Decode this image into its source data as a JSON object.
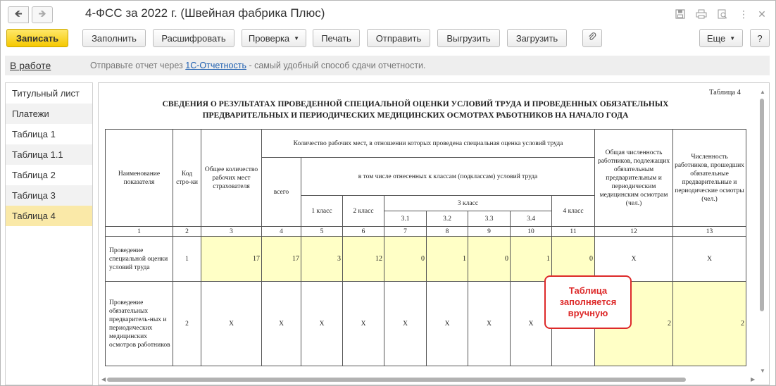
{
  "window": {
    "title": "4-ФСС за 2022 г. (Швейная фабрика Плюс)",
    "nav_back_icon": "arrow-left-icon",
    "nav_forward_icon": "arrow-right-icon"
  },
  "toolbar": {
    "save": "Записать",
    "fill": "Заполнить",
    "decode": "Расшифровать",
    "check": "Проверка",
    "print": "Печать",
    "send": "Отправить",
    "export": "Выгрузить",
    "import": "Загрузить",
    "more": "Еще",
    "help": "?"
  },
  "status": {
    "state": "В работе",
    "msg_before": "Отправьте отчет через ",
    "msg_link": "1С-Отчетность",
    "msg_after": " - самый удобный способ сдачи отчетности."
  },
  "sidebar": {
    "items": [
      {
        "label": "Титульный лист"
      },
      {
        "label": "Платежи"
      },
      {
        "label": "Таблица 1"
      },
      {
        "label": "Таблица 1.1"
      },
      {
        "label": "Таблица 2"
      },
      {
        "label": "Таблица 3"
      },
      {
        "label": "Таблица 4"
      }
    ],
    "active_index": 6
  },
  "document": {
    "table_label": "Таблица 4",
    "heading_line1": "СВЕДЕНИЯ  О РЕЗУЛЬТАТАХ ПРОВЕДЕННОЙ СПЕЦИАЛЬНОЙ ОЦЕНКИ УСЛОВИЙ ТРУДА И ПРОВЕДЕННЫХ ОБЯЗАТЕЛЬНЫХ",
    "heading_line2": "ПРЕДВАРИТЕЛЬНЫХ И ПЕРИОДИЧЕСКИХ МЕДИЦИНСКИХ ОСМОТРАХ РАБОТНИКОВ НА НАЧАЛО ГОДА",
    "headers": {
      "name": "Наименование показателя",
      "code": "Код стро-ки",
      "total_places": "Общее количество рабочих мест страхователя",
      "assessed_group": "Количество рабочих мест, в отношении которых проведена специальная оценка условий труда",
      "all": "всего",
      "classes_group": "в том числе отнесенных к классам (подклассам) условий труда",
      "class1": "1 класс",
      "class2": "2 класс",
      "class3": "3 класс",
      "c31": "3.1",
      "c32": "3.2",
      "c33": "3.3",
      "c34": "3.4",
      "class4": "4 класс",
      "workers_subject": "Общая численность работников, подлежащих обязательным предварительным и периодическим медицинским осмотрам (чел.)",
      "workers_passed": "Численность работников, прошедших обязательные предварительные и периодические осмотры (чел.)"
    },
    "column_numbers": [
      "1",
      "2",
      "3",
      "4",
      "5",
      "6",
      "7",
      "8",
      "9",
      "10",
      "11",
      "12",
      "13"
    ],
    "rows": [
      {
        "name": "Проведение специальной оценки условий труда",
        "code": "1",
        "cells": [
          "17",
          "17",
          "3",
          "12",
          "0",
          "1",
          "0",
          "1",
          "0",
          "X",
          "X"
        ]
      },
      {
        "name": "Проведение обязательных предваритель-ных и периодических медицинских осмотров работников",
        "code": "2",
        "cells": [
          "X",
          "X",
          "X",
          "X",
          "X",
          "X",
          "X",
          "X",
          "",
          "2",
          "2"
        ]
      }
    ],
    "callout": "Таблица заполняется вручную"
  },
  "colors": {
    "save_button": "#f5c800",
    "highlight_cell": "#ffffc6",
    "active_sidebar": "#fae9a8",
    "callout_border": "#dd2a2a",
    "link": "#2060b0"
  }
}
